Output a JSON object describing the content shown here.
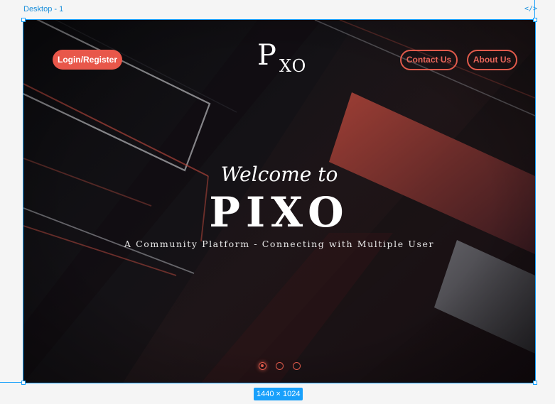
{
  "editor": {
    "frame_name": "Desktop - 1",
    "code_icon": "</>",
    "frame_size": "1440 × 1024",
    "selection_color": "#18a0fb"
  },
  "site": {
    "logo": {
      "main": "P",
      "suffix": "XO"
    },
    "nav": {
      "login_label": "Login/Register",
      "contact_label": "Contact Us",
      "about_label": "About Us"
    },
    "hero": {
      "welcome": "Welcome to",
      "title": "PIXO",
      "subtitle": "A Community Platform - Connecting with Multiple User"
    },
    "carousel": {
      "slide_count": 3,
      "active_index": 0
    },
    "colors": {
      "accent": "#e8574a",
      "background": "#0b0b0e",
      "text": "#ffffff"
    }
  }
}
